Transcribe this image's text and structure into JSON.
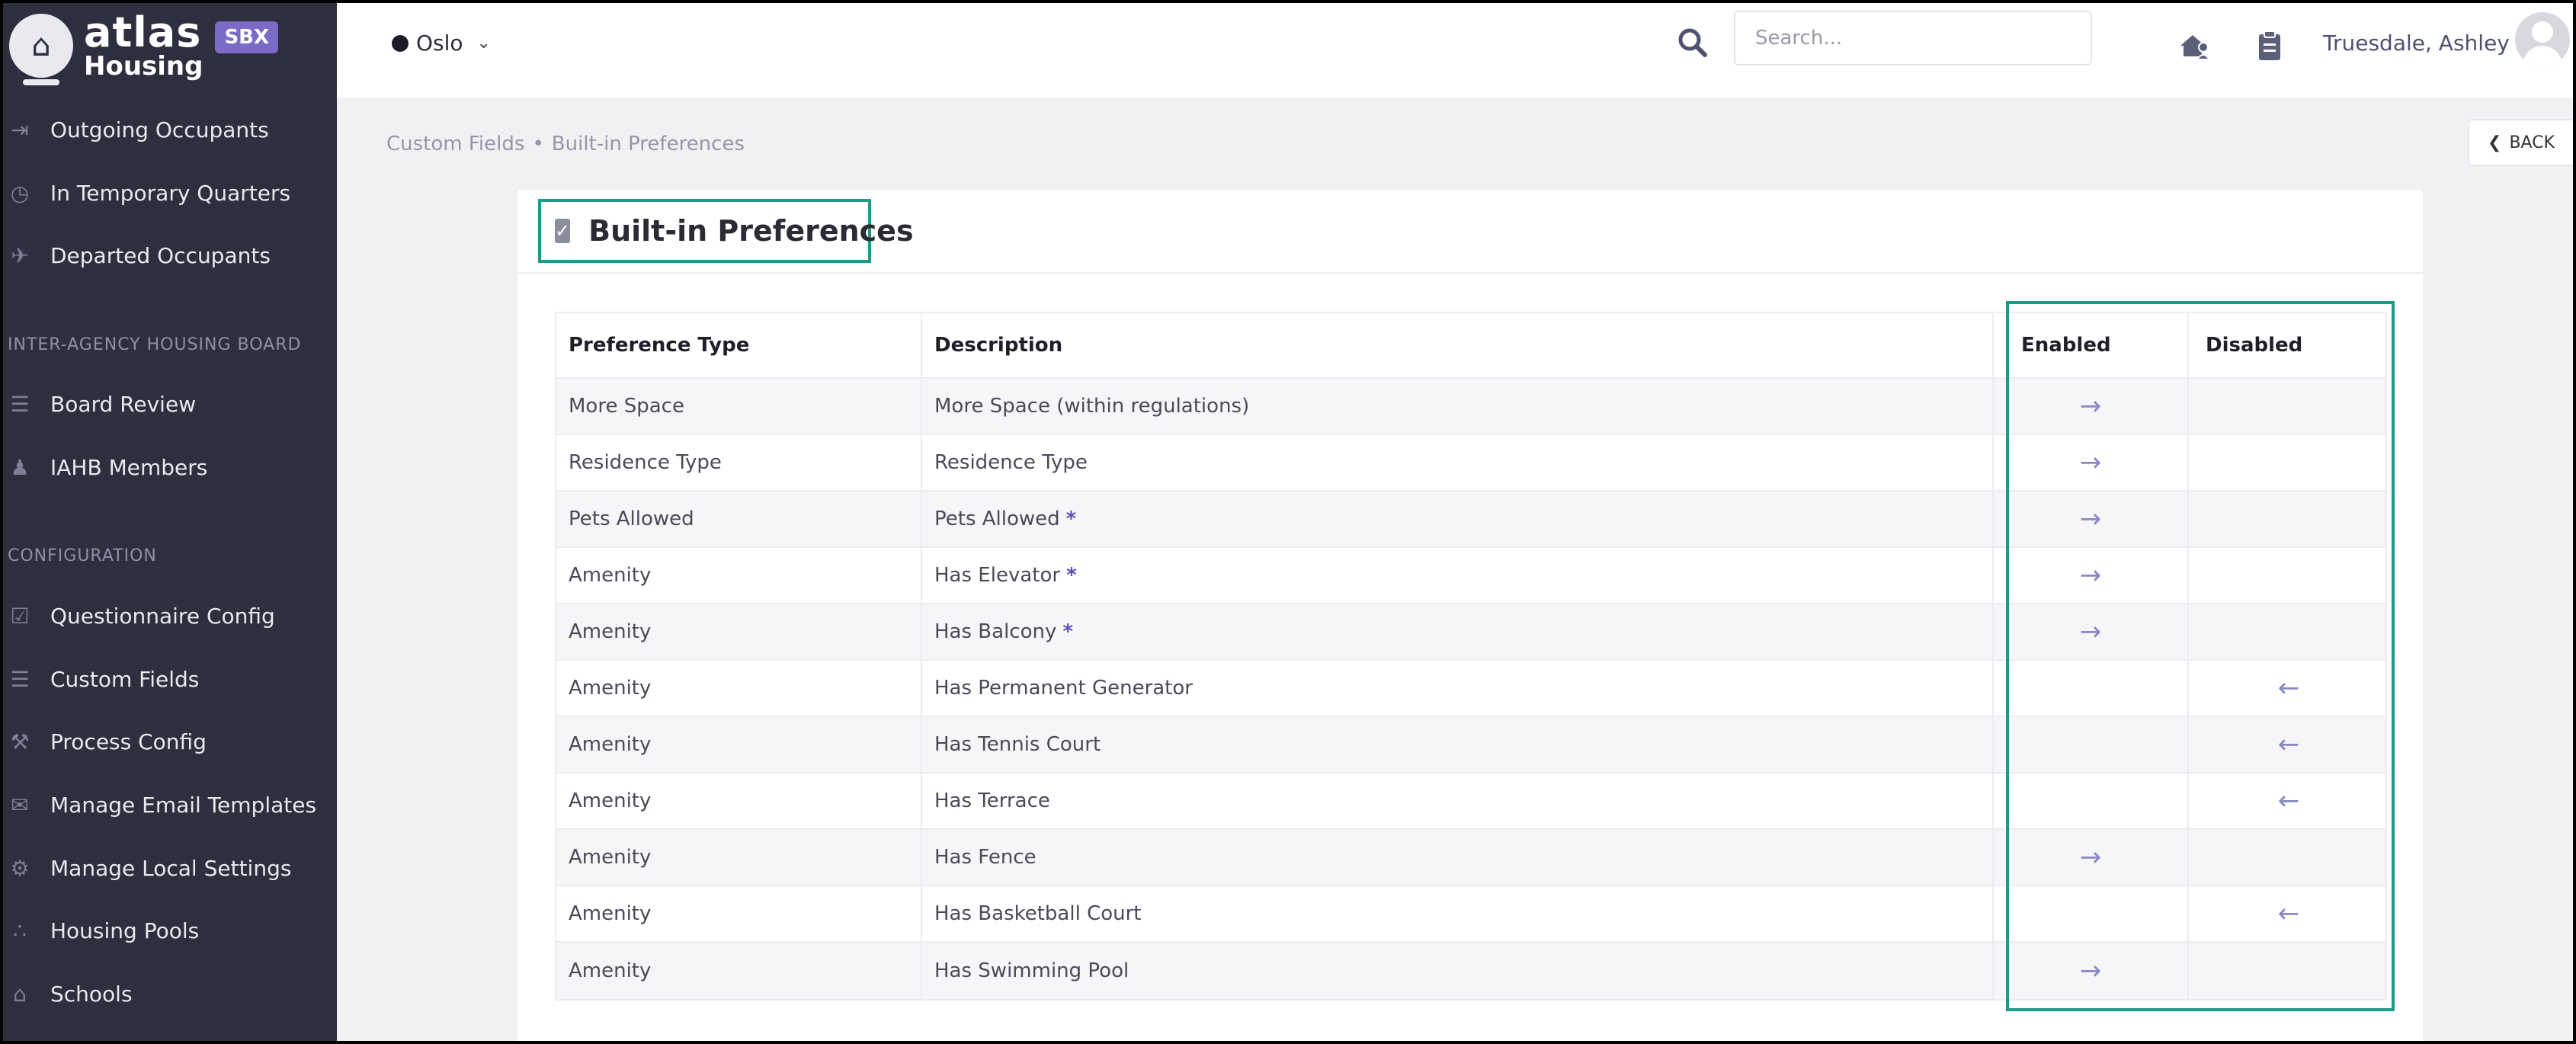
{
  "brand": {
    "logo_line1": "atlas",
    "logo_line2": "Housing",
    "env_badge": "SBX"
  },
  "sidebar": {
    "items_top": [
      {
        "label": "Outgoing Occupants",
        "icon": "exit-icon"
      },
      {
        "label": "In Temporary Quarters",
        "icon": "clock-icon"
      },
      {
        "label": "Departed Occupants",
        "icon": "plane-icon"
      }
    ],
    "section_iahb": "INTER-AGENCY HOUSING BOARD",
    "items_iahb": [
      {
        "label": "Board Review",
        "icon": "list-icon"
      },
      {
        "label": "IAHB Members",
        "icon": "users-icon"
      }
    ],
    "section_config": "CONFIGURATION",
    "items_config": [
      {
        "label": "Questionnaire Config",
        "icon": "check-icon"
      },
      {
        "label": "Custom Fields",
        "icon": "list-icon"
      },
      {
        "label": "Process Config",
        "icon": "wrench-icon"
      },
      {
        "label": "Manage Email Templates",
        "icon": "envelope-icon"
      },
      {
        "label": "Manage Local Settings",
        "icon": "gear-icon"
      },
      {
        "label": "Housing Pools",
        "icon": "dots-icon"
      },
      {
        "label": "Schools",
        "icon": "school-icon"
      }
    ]
  },
  "topbar": {
    "location": "Oslo",
    "search_placeholder": "Search...",
    "user_name": "Truesdale, Ashley A"
  },
  "breadcrumb": {
    "parent": "Custom Fields",
    "separator": "•",
    "current": "Built-in Preferences"
  },
  "back_label": "BACK",
  "card": {
    "title": "Built-in Preferences"
  },
  "table": {
    "headers": [
      "Preference Type",
      "Description",
      "Enabled",
      "Disabled"
    ],
    "rows": [
      {
        "type": "More Space",
        "description": "More Space (within regulations)",
        "required": false,
        "status": "enabled"
      },
      {
        "type": "Residence Type",
        "description": "Residence Type",
        "required": false,
        "status": "enabled"
      },
      {
        "type": "Pets Allowed",
        "description": "Pets Allowed",
        "required": true,
        "status": "enabled"
      },
      {
        "type": "Amenity",
        "description": "Has Elevator",
        "required": true,
        "status": "enabled"
      },
      {
        "type": "Amenity",
        "description": "Has Balcony",
        "required": true,
        "status": "enabled"
      },
      {
        "type": "Amenity",
        "description": "Has Permanent Generator",
        "required": false,
        "status": "disabled"
      },
      {
        "type": "Amenity",
        "description": "Has Tennis Court",
        "required": false,
        "status": "disabled"
      },
      {
        "type": "Amenity",
        "description": "Has Terrace",
        "required": false,
        "status": "disabled"
      },
      {
        "type": "Amenity",
        "description": "Has Fence",
        "required": false,
        "status": "enabled"
      },
      {
        "type": "Amenity",
        "description": "Has Basketball Court",
        "required": false,
        "status": "disabled"
      },
      {
        "type": "Amenity",
        "description": "Has Swimming Pool",
        "required": false,
        "status": "enabled"
      }
    ],
    "required_marker": "*"
  },
  "colors": {
    "sidebar_bg": "#2d2f3e",
    "highlight": "#1f9a86",
    "accent": "#7b6bc6",
    "arrow": "#8a88c4"
  }
}
